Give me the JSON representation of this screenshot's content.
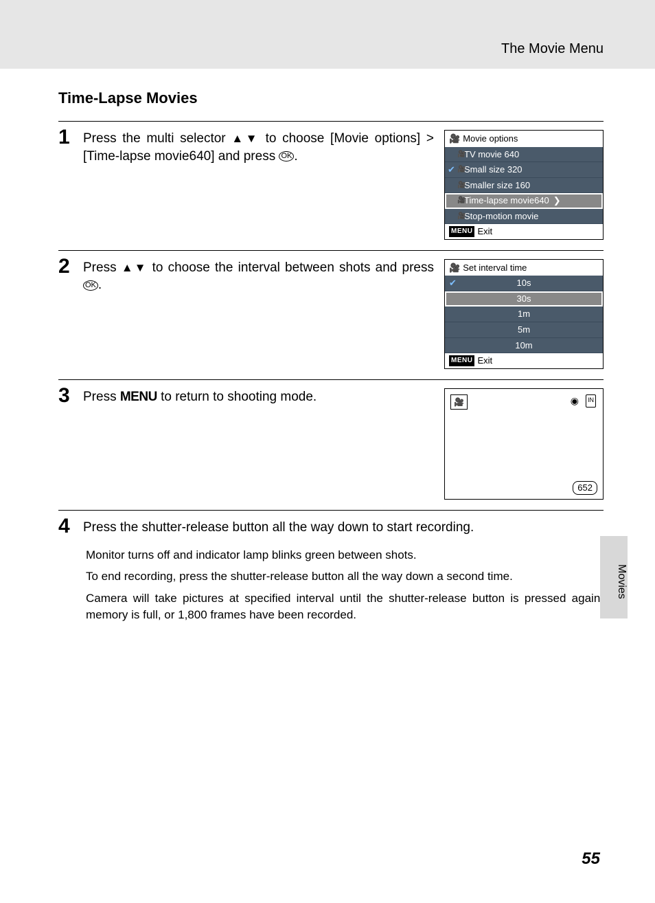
{
  "header": {
    "title": "The Movie Menu"
  },
  "section_title": "Time-Lapse Movies",
  "steps": [
    {
      "num": "1",
      "text_a": "Press the multi selector ",
      "text_b": " to choose [Movie options] > [Time-lapse movie640] and press ",
      "text_c": "."
    },
    {
      "num": "2",
      "text_a": "Press ",
      "text_b": " to choose the interval between shots and press ",
      "text_c": "."
    },
    {
      "num": "3",
      "text_a": "Press ",
      "text_b": " to return to shooting mode."
    },
    {
      "num": "4",
      "text_a": "Press the shutter-release button all the way down to start recording."
    }
  ],
  "lcd1": {
    "title": "Movie options",
    "items": [
      {
        "label": "TV movie 640"
      },
      {
        "label": "Small size 320",
        "checked": true
      },
      {
        "label": "Smaller size 160"
      },
      {
        "label": "Time-lapse movie640",
        "selected": true
      },
      {
        "label": "Stop-motion movie"
      }
    ],
    "exit": "Exit"
  },
  "lcd2": {
    "title": "Set interval time",
    "items": [
      {
        "label": "10s",
        "checked": true
      },
      {
        "label": "30s",
        "selected": true
      },
      {
        "label": "1m"
      },
      {
        "label": "5m"
      },
      {
        "label": "10m"
      }
    ],
    "exit": "Exit"
  },
  "lcd3": {
    "counter": "652"
  },
  "sub_paragraphs": [
    "Monitor turns off and indicator lamp blinks green between shots.",
    "To end recording, press the shutter-release button all the way down a second time.",
    "Camera will take pictures at specified interval until the shutter-release button is pressed again, memory is full, or 1,800 frames have been recorded."
  ],
  "side_tab": "Movies",
  "page_number": "55",
  "glyphs": {
    "up_down": "▲▼",
    "ok": "OK",
    "menu": "MENU",
    "movie_icon": "🎥",
    "chevron": "❯",
    "globe": "◉",
    "in": "IN"
  }
}
